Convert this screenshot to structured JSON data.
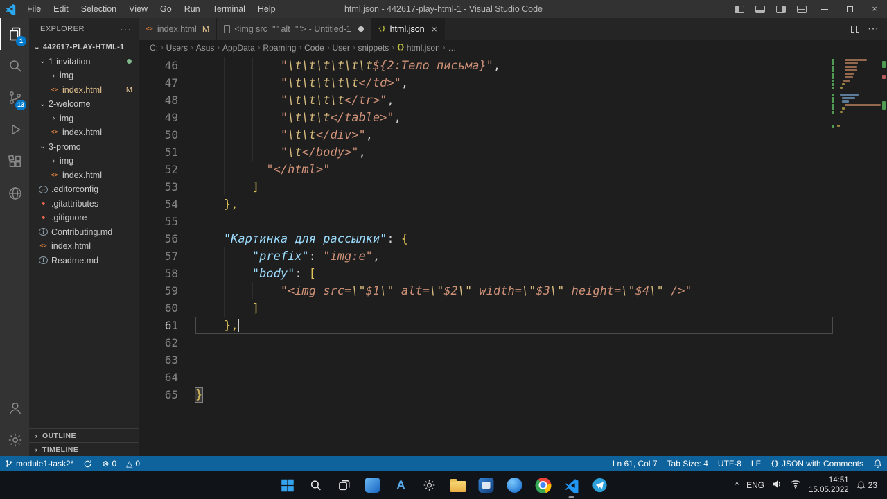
{
  "colors": {
    "accent": "#007acc",
    "statusbar-bg": "#0e639c",
    "activity-badge": "#007acc",
    "token-string": "#ce9178",
    "token-escape": "#d7ba7d",
    "token-key": "#9cdcfe",
    "token-punct": "#d4d4d4",
    "token-bracket": "#e2c45a",
    "git-modified": "#e2c08d",
    "git-added": "#81b88b"
  },
  "window": {
    "title": "html.json - 442617-play-html-1 - Visual Studio Code",
    "menus": [
      "File",
      "Edit",
      "Selection",
      "View",
      "Go",
      "Run",
      "Terminal",
      "Help"
    ]
  },
  "activity_bar": {
    "explorer_badge": "1",
    "scm_badge": "13"
  },
  "sidebar": {
    "header": "EXPLORER",
    "actions": "···",
    "root": "442617-PLAY-HTML-1",
    "tree": [
      {
        "label": "1-invitation",
        "type": "folder",
        "expanded": true,
        "level": 1,
        "dot": true
      },
      {
        "label": "img",
        "type": "folder",
        "expanded": false,
        "level": 2
      },
      {
        "label": "index.html",
        "type": "html",
        "level": 2,
        "badge": "M",
        "modified": true
      },
      {
        "label": "2-welcome",
        "type": "folder",
        "expanded": true,
        "level": 1
      },
      {
        "label": "img",
        "type": "folder",
        "expanded": false,
        "level": 2
      },
      {
        "label": "index.html",
        "type": "html",
        "level": 2
      },
      {
        "label": "3-promo",
        "type": "folder",
        "expanded": true,
        "level": 1
      },
      {
        "label": "img",
        "type": "folder",
        "expanded": false,
        "level": 2
      },
      {
        "label": "index.html",
        "type": "html",
        "level": 2
      },
      {
        "label": ".editorconfig",
        "type": "config",
        "level": 1
      },
      {
        "label": ".gitattributes",
        "type": "git",
        "level": 1
      },
      {
        "label": ".gitignore",
        "type": "git",
        "level": 1
      },
      {
        "label": "Contributing.md",
        "type": "md",
        "level": 1
      },
      {
        "label": "index.html",
        "type": "html",
        "level": 1
      },
      {
        "label": "Readme.md",
        "type": "md",
        "level": 1
      }
    ],
    "panels": [
      "OUTLINE",
      "TIMELINE"
    ]
  },
  "tabs": [
    {
      "label": "index.html",
      "icon": "html",
      "badge": "M"
    },
    {
      "label": "<img src=\"\" alt=\"\"> - Untitled-1",
      "icon": "file",
      "dirty": true
    },
    {
      "label": "html.json",
      "icon": "json",
      "active": true,
      "close": true
    }
  ],
  "breadcrumbs": [
    {
      "label": "C:"
    },
    {
      "label": "Users"
    },
    {
      "label": "Asus"
    },
    {
      "label": "AppData"
    },
    {
      "label": "Roaming"
    },
    {
      "label": "Code"
    },
    {
      "label": "User"
    },
    {
      "label": "snippets"
    },
    {
      "label": "html.json",
      "icon": "json"
    },
    {
      "label": "…"
    }
  ],
  "editor": {
    "cursor": {
      "line": 61,
      "col": 7
    },
    "lines": [
      {
        "n": 46,
        "indent": 12,
        "tokens": [
          [
            "str",
            "\""
          ],
          [
            "esc",
            "\\t\\t\\t\\t\\t\\t"
          ],
          [
            "str",
            "${2:Тело письма}\""
          ],
          [
            "punct",
            ","
          ]
        ]
      },
      {
        "n": 47,
        "indent": 12,
        "tokens": [
          [
            "str",
            "\""
          ],
          [
            "esc",
            "\\t\\t\\t\\t\\t"
          ],
          [
            "str",
            "</td>\""
          ],
          [
            "punct",
            ","
          ]
        ]
      },
      {
        "n": 48,
        "indent": 12,
        "tokens": [
          [
            "str",
            "\""
          ],
          [
            "esc",
            "\\t\\t\\t\\t"
          ],
          [
            "str",
            "</tr>\""
          ],
          [
            "punct",
            ","
          ]
        ]
      },
      {
        "n": 49,
        "indent": 12,
        "tokens": [
          [
            "str",
            "\""
          ],
          [
            "esc",
            "\\t\\t\\t"
          ],
          [
            "str",
            "</table>\""
          ],
          [
            "punct",
            ","
          ]
        ]
      },
      {
        "n": 50,
        "indent": 12,
        "tokens": [
          [
            "str",
            "\""
          ],
          [
            "esc",
            "\\t\\t"
          ],
          [
            "str",
            "</div>\""
          ],
          [
            "punct",
            ","
          ]
        ]
      },
      {
        "n": 51,
        "indent": 12,
        "tokens": [
          [
            "str",
            "\""
          ],
          [
            "esc",
            "\\t"
          ],
          [
            "str",
            "</body>\""
          ],
          [
            "punct",
            ","
          ]
        ]
      },
      {
        "n": 52,
        "indent": 10,
        "tokens": [
          [
            "str",
            "\"</html>\""
          ]
        ]
      },
      {
        "n": 53,
        "indent": 8,
        "tokens": [
          [
            "bracket",
            "]"
          ]
        ]
      },
      {
        "n": 54,
        "indent": 4,
        "tokens": [
          [
            "bracket",
            "},"
          ]
        ]
      },
      {
        "n": 55,
        "indent": 0,
        "tokens": []
      },
      {
        "n": 56,
        "indent": 4,
        "tokens": [
          [
            "key",
            "\"Картинка для рассылки\""
          ],
          [
            "punct",
            ": "
          ],
          [
            "bracket",
            "{"
          ]
        ]
      },
      {
        "n": 57,
        "indent": 8,
        "tokens": [
          [
            "key",
            "\"prefix\""
          ],
          [
            "punct",
            ": "
          ],
          [
            "str",
            "\"img:e\""
          ],
          [
            "punct",
            ","
          ]
        ]
      },
      {
        "n": 58,
        "indent": 8,
        "tokens": [
          [
            "key",
            "\"body\""
          ],
          [
            "punct",
            ": "
          ],
          [
            "bracket",
            "["
          ]
        ]
      },
      {
        "n": 59,
        "indent": 12,
        "tokens": [
          [
            "str",
            "\"<img src="
          ],
          [
            "esc",
            "\\\""
          ],
          [
            "str",
            "$1"
          ],
          [
            "esc",
            "\\\""
          ],
          [
            "str",
            " alt="
          ],
          [
            "esc",
            "\\\""
          ],
          [
            "str",
            "$2"
          ],
          [
            "esc",
            "\\\""
          ],
          [
            "str",
            " width="
          ],
          [
            "esc",
            "\\\""
          ],
          [
            "str",
            "$3"
          ],
          [
            "esc",
            "\\\""
          ],
          [
            "str",
            " height="
          ],
          [
            "esc",
            "\\\""
          ],
          [
            "str",
            "$4"
          ],
          [
            "esc",
            "\\\""
          ],
          [
            "str",
            " />\""
          ]
        ]
      },
      {
        "n": 60,
        "indent": 8,
        "tokens": [
          [
            "bracket",
            "]"
          ]
        ]
      },
      {
        "n": 61,
        "indent": 4,
        "tokens": [
          [
            "bracket",
            "},"
          ]
        ],
        "current": true
      },
      {
        "n": 62,
        "indent": 0,
        "tokens": []
      },
      {
        "n": 63,
        "indent": 0,
        "tokens": []
      },
      {
        "n": 64,
        "indent": 0,
        "tokens": []
      },
      {
        "n": 65,
        "indent": 0,
        "tokens": [
          [
            "bracket",
            "}"
          ]
        ],
        "match": true
      }
    ]
  },
  "status_bar": {
    "left": [
      {
        "name": "branch",
        "icon": "branch",
        "label": "module1-task2*"
      },
      {
        "name": "sync",
        "icon": "sync",
        "label": ""
      },
      {
        "name": "errors",
        "icon": "error",
        "label": "0"
      },
      {
        "name": "warnings",
        "icon": "warning",
        "label": "0"
      }
    ],
    "right": [
      {
        "name": "cursor-position",
        "label": "Ln 61, Col 7"
      },
      {
        "name": "tab-size",
        "label": "Tab Size: 4"
      },
      {
        "name": "encoding",
        "label": "UTF-8"
      },
      {
        "name": "eol",
        "label": "LF"
      },
      {
        "name": "language-mode",
        "icon": "braces",
        "label": "JSON with Comments"
      },
      {
        "name": "notifications",
        "icon": "bell",
        "label": ""
      }
    ]
  },
  "taskbar": {
    "icons": [
      {
        "name": "start"
      },
      {
        "name": "search"
      },
      {
        "name": "task-view"
      },
      {
        "name": "widgets"
      },
      {
        "name": "app-a"
      },
      {
        "name": "settings"
      },
      {
        "name": "file-explorer"
      },
      {
        "name": "app-blue"
      },
      {
        "name": "app-circle"
      },
      {
        "name": "chrome"
      },
      {
        "name": "vscode",
        "active": true
      },
      {
        "name": "telegram"
      }
    ],
    "tray": {
      "chevron": "^",
      "lang": "ENG",
      "time": "14:51",
      "date": "15.05.2022",
      "notifications": "23"
    }
  }
}
